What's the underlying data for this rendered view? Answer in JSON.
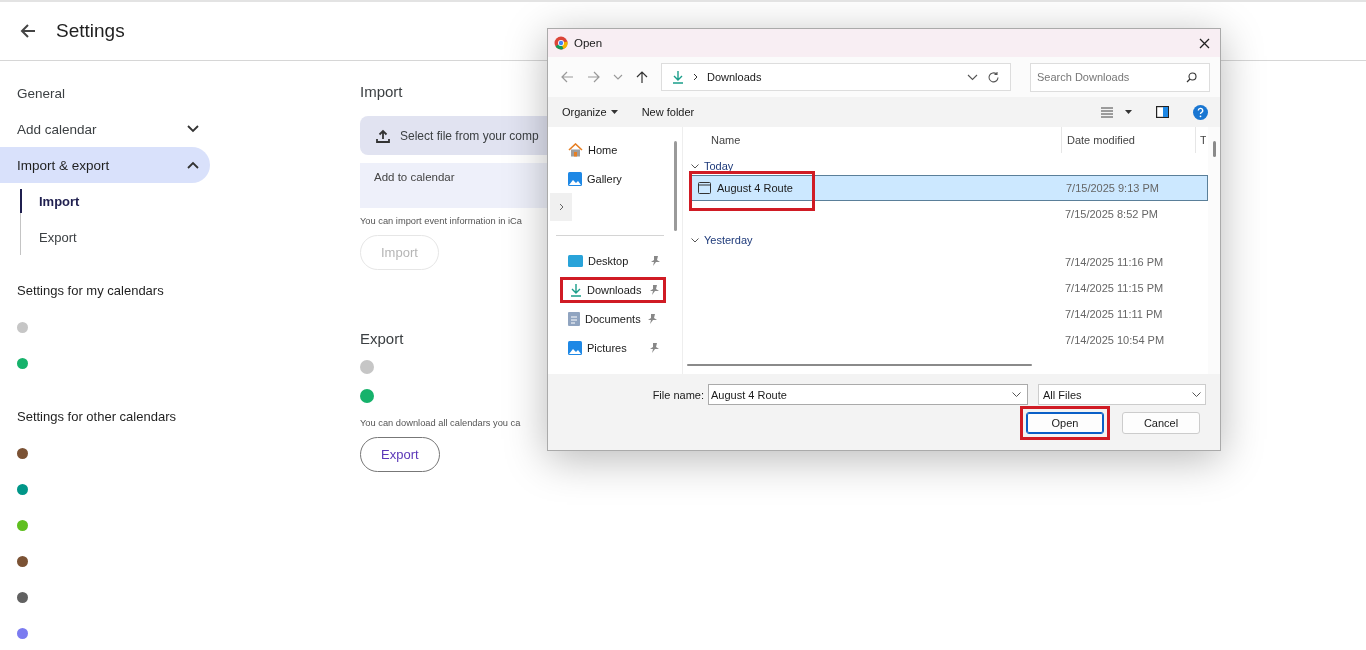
{
  "header": {
    "title": "Settings"
  },
  "sidebar": {
    "items": [
      {
        "label": "General",
        "kind": "link",
        "selected": false
      },
      {
        "label": "Add calendar",
        "kind": "group",
        "selected": false,
        "expanded": false
      },
      {
        "label": "Import & export",
        "kind": "group",
        "selected": true,
        "expanded": true,
        "children": [
          {
            "label": "Import",
            "selected": true
          },
          {
            "label": "Export",
            "selected": false
          }
        ]
      }
    ],
    "sections": [
      {
        "title": "Settings for my calendars",
        "calendars": [
          {
            "color": "#c6c6c6"
          },
          {
            "color": "#16b26b"
          }
        ]
      },
      {
        "title": "Settings for other calendars",
        "calendars": [
          {
            "color": "#7b5234"
          },
          {
            "color": "#009688"
          },
          {
            "color": "#5fbf1f"
          },
          {
            "color": "#7b5234"
          },
          {
            "color": "#616161"
          },
          {
            "color": "#7b7bf0"
          }
        ]
      }
    ]
  },
  "import": {
    "title": "Import",
    "select_button": "Select file from your comp",
    "field": {
      "label": "Add to calendar"
    },
    "note": "You can import event information in iCa",
    "button": {
      "label": "Import",
      "disabled": true
    }
  },
  "export": {
    "title": "Export",
    "calendars": [
      {
        "color": "#c6c6c6"
      },
      {
        "color": "#16b26b"
      }
    ],
    "note": "You can download all calendars you ca",
    "button": {
      "label": "Export",
      "disabled": false
    }
  },
  "dialog": {
    "title": "Open",
    "address": {
      "path": "Downloads"
    },
    "search": {
      "placeholder": "Search Downloads"
    },
    "toolbar": [
      {
        "label": "Organize",
        "kind": "menu"
      },
      {
        "label": "New folder",
        "kind": "button"
      }
    ],
    "nav": [
      {
        "label": "Home",
        "kind": "home",
        "pinned": false,
        "highlighted": false
      },
      {
        "label": "Gallery",
        "kind": "gallery",
        "pinned": false,
        "highlighted": false
      },
      {
        "kind": "expander"
      },
      {
        "kind": "divider"
      },
      {
        "label": "Desktop",
        "kind": "desktop",
        "pinned": true,
        "highlighted": false
      },
      {
        "label": "Downloads",
        "kind": "downloads",
        "pinned": true,
        "highlighted": true
      },
      {
        "label": "Documents",
        "kind": "documents",
        "pinned": true,
        "highlighted": false
      },
      {
        "label": "Pictures",
        "kind": "pictures",
        "pinned": true,
        "highlighted": false
      }
    ],
    "columns": [
      "Name",
      "Date modified",
      "T"
    ],
    "groups": [
      {
        "label": "Today",
        "files": [
          {
            "name": "August 4 Route",
            "date": "7/15/2025 9:13 PM",
            "selected": true,
            "highlighted": true
          },
          {
            "date": "7/15/2025 8:52 PM",
            "selected": false,
            "highlighted": false
          }
        ]
      },
      {
        "label": "Yesterday",
        "files": [
          {
            "date": "7/14/2025 11:16 PM",
            "selected": false,
            "highlighted": false
          },
          {
            "date": "7/14/2025 11:15 PM",
            "selected": false,
            "highlighted": false
          },
          {
            "date": "7/14/2025 11:11 PM",
            "selected": false,
            "highlighted": false
          },
          {
            "date": "7/14/2025 10:54 PM",
            "selected": false,
            "highlighted": false
          }
        ]
      }
    ],
    "file_name": {
      "label": "File name:",
      "value": "August 4 Route"
    },
    "file_type": {
      "value": "All Files"
    },
    "buttons": [
      {
        "label": "Open",
        "default": true,
        "highlighted": true
      },
      {
        "label": "Cancel",
        "default": false,
        "highlighted": false
      }
    ]
  }
}
